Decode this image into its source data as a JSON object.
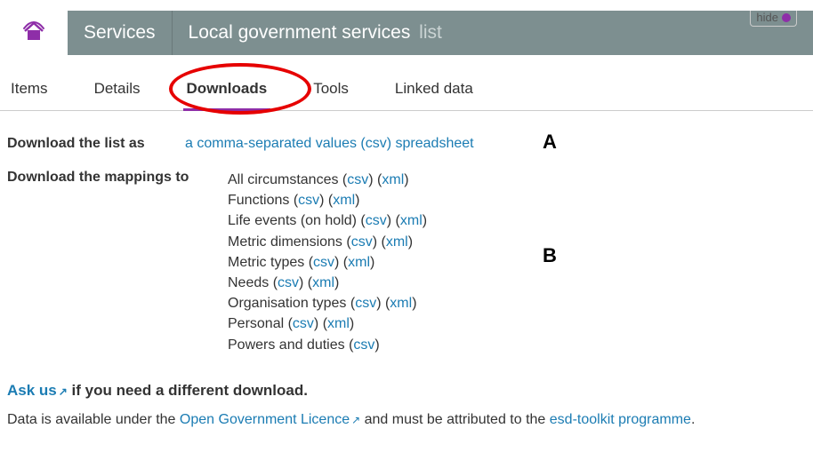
{
  "hide": {
    "label": "hide"
  },
  "header": {
    "services_label": "Services",
    "title": "Local government services",
    "suffix": "list"
  },
  "tabs": {
    "items": "Items",
    "details": "Details",
    "downloads": "Downloads",
    "tools": "Tools",
    "linked_data": "Linked data"
  },
  "download_list": {
    "label": "Download the list as",
    "link": "a comma-separated values (csv) spreadsheet"
  },
  "annotations": {
    "a": "A",
    "b": "B"
  },
  "mappings": {
    "label": "Download the mappings to",
    "rows": [
      {
        "name": "All circumstances",
        "csv": "csv",
        "xml": "xml"
      },
      {
        "name": "Functions",
        "csv": "csv",
        "xml": "xml"
      },
      {
        "name": "Life events (on hold)",
        "csv": "csv",
        "xml": "xml"
      },
      {
        "name": "Metric dimensions",
        "csv": "csv",
        "xml": "xml"
      },
      {
        "name": "Metric types",
        "csv": "csv",
        "xml": "xml"
      },
      {
        "name": "Needs",
        "csv": "csv",
        "xml": "xml"
      },
      {
        "name": "Organisation types",
        "csv": "csv",
        "xml": "xml"
      },
      {
        "name": "Personal",
        "csv": "csv",
        "xml": "xml"
      },
      {
        "name": "Powers and duties",
        "csv": "csv",
        "xml": null
      }
    ]
  },
  "ask": {
    "link": "Ask us",
    "rest": " if you need a different download."
  },
  "licence": {
    "pre": "Data is available under the ",
    "ogl": "Open Government Licence",
    "mid": " and must be attributed to the ",
    "esd": "esd-toolkit programme",
    "end": "."
  },
  "glyph": {
    "ext": "↗"
  }
}
